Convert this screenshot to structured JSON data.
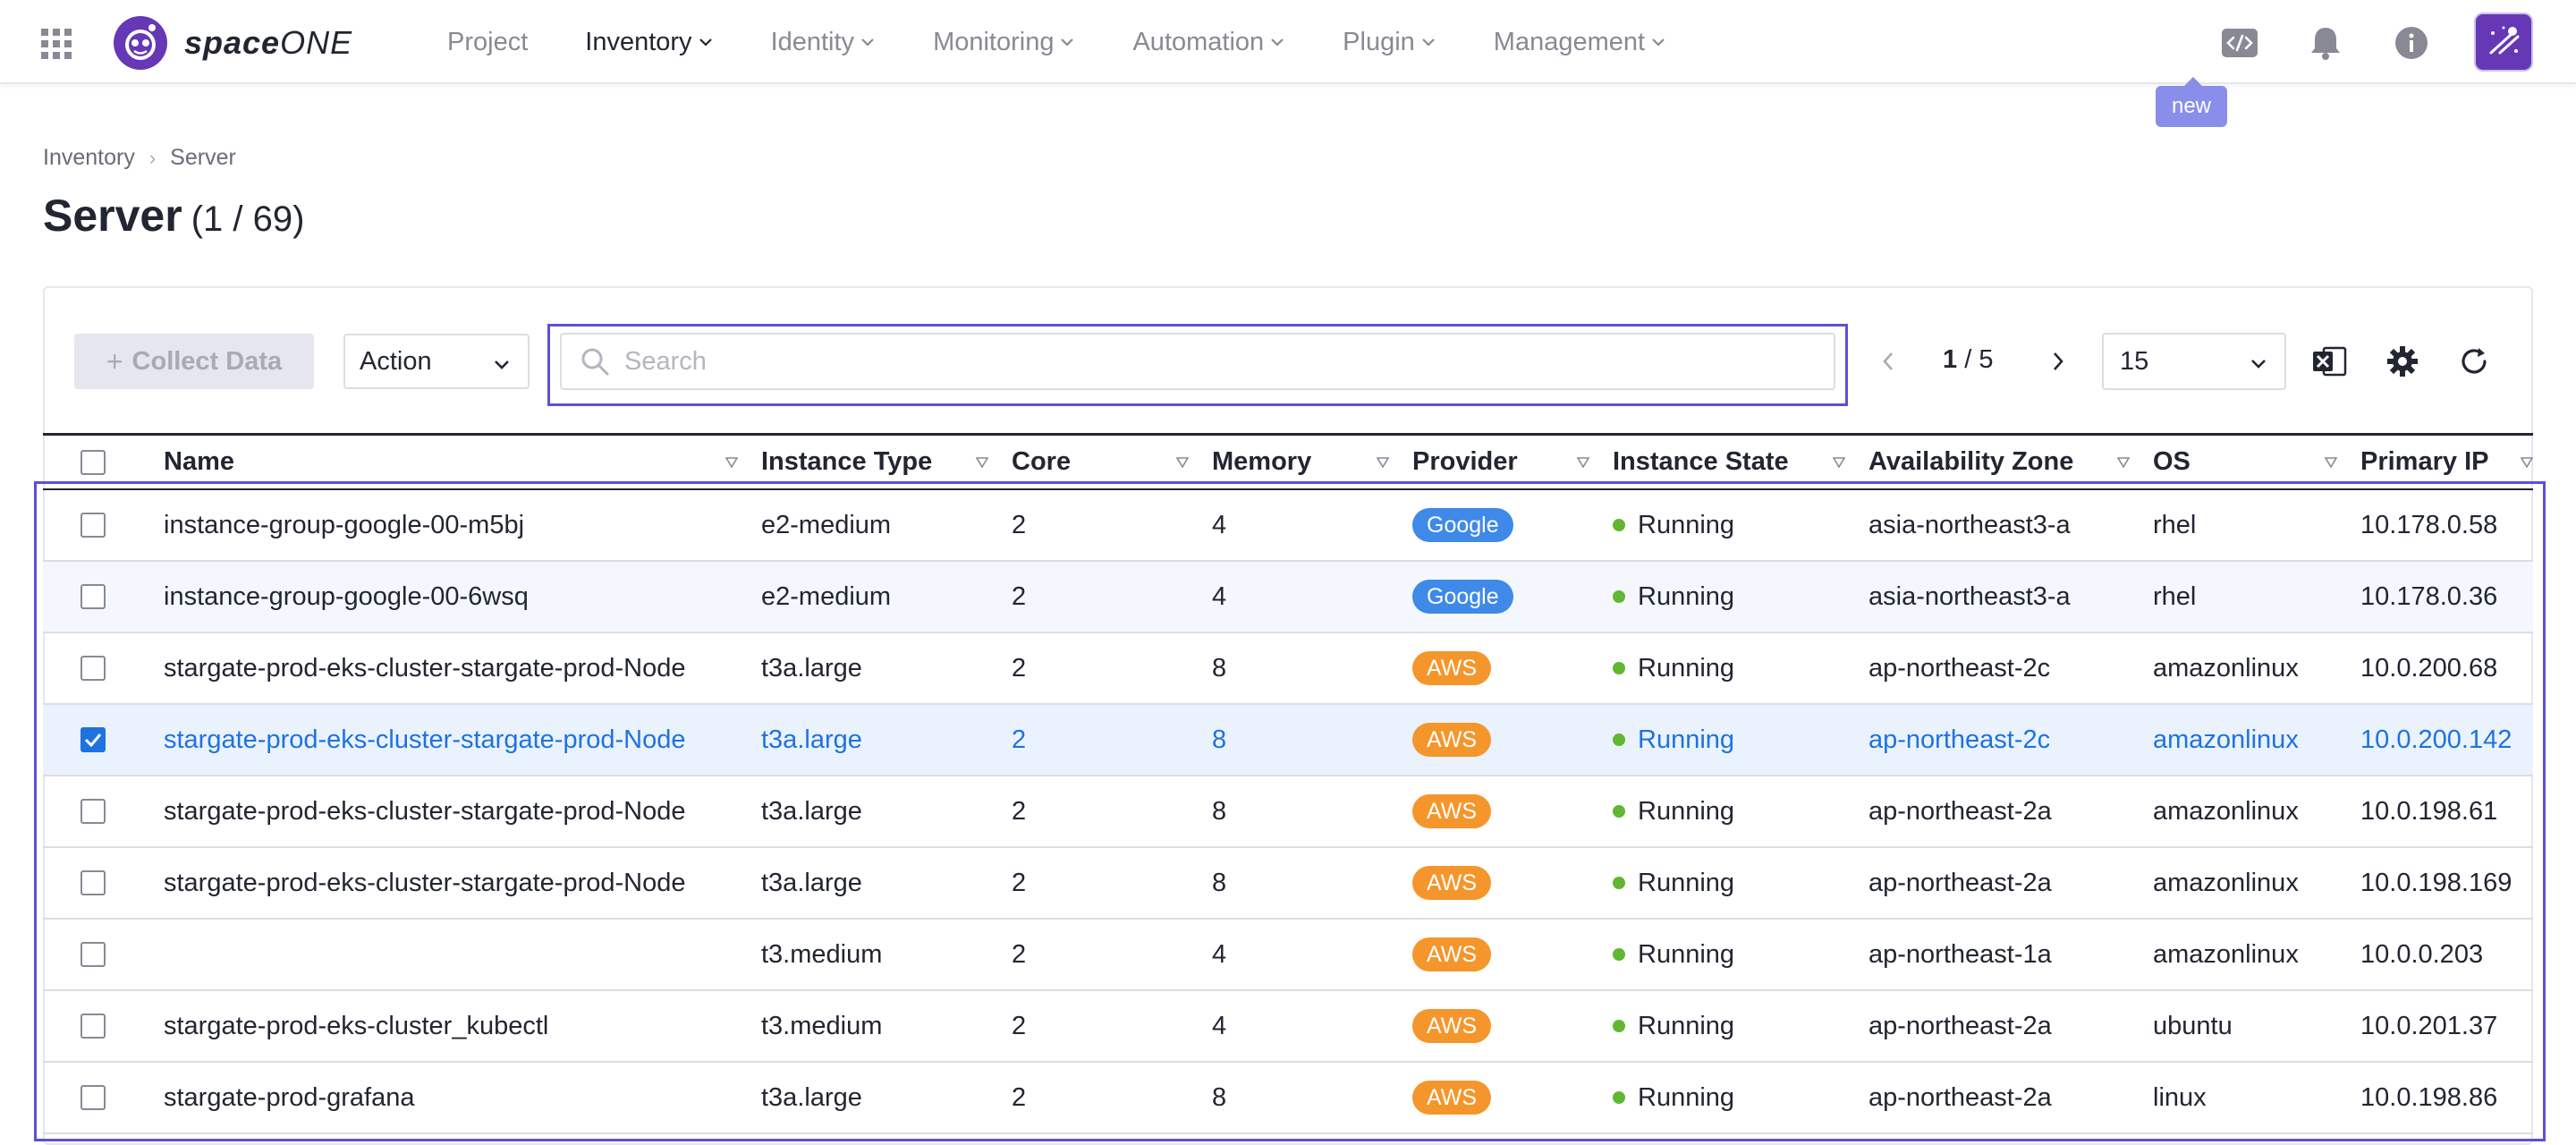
{
  "app": {
    "brand_bold": "space",
    "brand_thin": "ONE",
    "new_badge": "new"
  },
  "nav": [
    {
      "label": "Project",
      "has_menu": false,
      "active": false
    },
    {
      "label": "Inventory",
      "has_menu": true,
      "active": true
    },
    {
      "label": "Identity",
      "has_menu": true,
      "active": false
    },
    {
      "label": "Monitoring",
      "has_menu": true,
      "active": false
    },
    {
      "label": "Automation",
      "has_menu": true,
      "active": false
    },
    {
      "label": "Plugin",
      "has_menu": true,
      "active": false
    },
    {
      "label": "Management",
      "has_menu": true,
      "active": false
    }
  ],
  "header_icons": [
    "code-icon",
    "bell-icon",
    "info-icon",
    "user-avatar"
  ],
  "breadcrumb": [
    "Inventory",
    "Server"
  ],
  "page": {
    "title": "Server",
    "count": "(1 / 69)"
  },
  "toolbar": {
    "collect_label": "Collect Data",
    "action_label": "Action",
    "search_placeholder": "Search",
    "page_current": "1",
    "page_total": "/ 5",
    "page_size": "15"
  },
  "columns": [
    "Name",
    "Instance Type",
    "Core",
    "Memory",
    "Provider",
    "Instance State",
    "Availability Zone",
    "OS",
    "Primary IP"
  ],
  "colors": {
    "google": "#3f8ae8",
    "aws": "#f5962c",
    "running": "#60b731",
    "accent": "#1e73e0",
    "frame": "#5b4fdc"
  },
  "rows": [
    {
      "name": "instance-group-google-00-m5bj",
      "type": "e2-medium",
      "core": "2",
      "memory": "4",
      "provider": "Google",
      "state": "Running",
      "zone": "asia-northeast3-a",
      "os": "rhel",
      "ip": "10.178.0.58",
      "checked": false
    },
    {
      "name": "instance-group-google-00-6wsq",
      "type": "e2-medium",
      "core": "2",
      "memory": "4",
      "provider": "Google",
      "state": "Running",
      "zone": "asia-northeast3-a",
      "os": "rhel",
      "ip": "10.178.0.36",
      "checked": false
    },
    {
      "name": "stargate-prod-eks-cluster-stargate-prod-Node",
      "type": "t3a.large",
      "core": "2",
      "memory": "8",
      "provider": "AWS",
      "state": "Running",
      "zone": "ap-northeast-2c",
      "os": "amazonlinux",
      "ip": "10.0.200.68",
      "checked": false
    },
    {
      "name": "stargate-prod-eks-cluster-stargate-prod-Node",
      "type": "t3a.large",
      "core": "2",
      "memory": "8",
      "provider": "AWS",
      "state": "Running",
      "zone": "ap-northeast-2c",
      "os": "amazonlinux",
      "ip": "10.0.200.142",
      "checked": true
    },
    {
      "name": "stargate-prod-eks-cluster-stargate-prod-Node",
      "type": "t3a.large",
      "core": "2",
      "memory": "8",
      "provider": "AWS",
      "state": "Running",
      "zone": "ap-northeast-2a",
      "os": "amazonlinux",
      "ip": "10.0.198.61",
      "checked": false
    },
    {
      "name": "stargate-prod-eks-cluster-stargate-prod-Node",
      "type": "t3a.large",
      "core": "2",
      "memory": "8",
      "provider": "AWS",
      "state": "Running",
      "zone": "ap-northeast-2a",
      "os": "amazonlinux",
      "ip": "10.0.198.169",
      "checked": false
    },
    {
      "name": "",
      "type": "t3.medium",
      "core": "2",
      "memory": "4",
      "provider": "AWS",
      "state": "Running",
      "zone": "ap-northeast-1a",
      "os": "amazonlinux",
      "ip": "10.0.0.203",
      "checked": false
    },
    {
      "name": "stargate-prod-eks-cluster_kubectl",
      "type": "t3.medium",
      "core": "2",
      "memory": "4",
      "provider": "AWS",
      "state": "Running",
      "zone": "ap-northeast-2a",
      "os": "ubuntu",
      "ip": "10.0.201.37",
      "checked": false
    },
    {
      "name": "stargate-prod-grafana",
      "type": "t3a.large",
      "core": "2",
      "memory": "8",
      "provider": "AWS",
      "state": "Running",
      "zone": "ap-northeast-2a",
      "os": "linux",
      "ip": "10.0.198.86",
      "checked": false
    }
  ]
}
